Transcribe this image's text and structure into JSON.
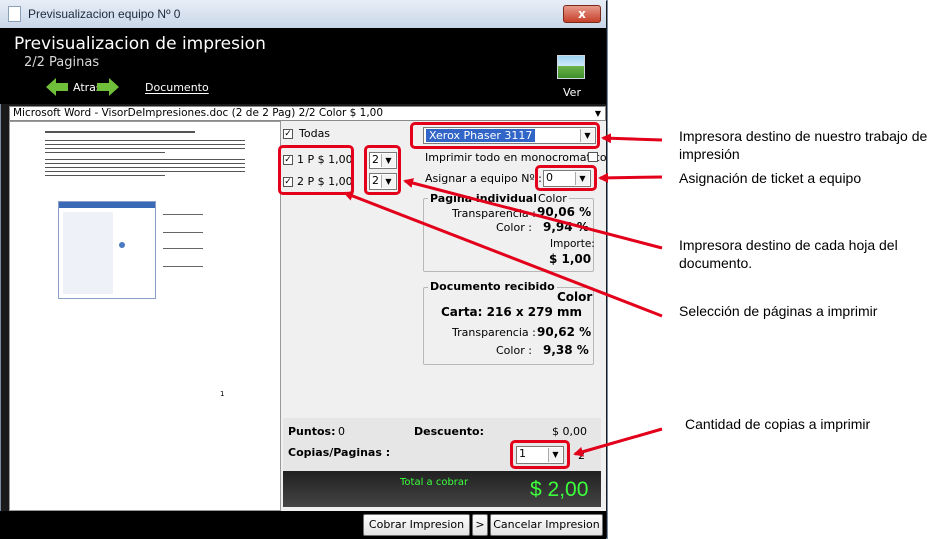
{
  "window": {
    "title": "Previsualizacion equipo Nº 0",
    "close_label": "x"
  },
  "header": {
    "title": "Previsualizacion de impresion",
    "subtitle": "2/2 Paginas",
    "back_label": "Atras",
    "document_label": "Documento",
    "ver_label": "Ver"
  },
  "document_selector": {
    "value": "Microsoft Word - VisorDeImpresiones.doc (2 de 2 Pag) 2/2 Color $ 1,00"
  },
  "preview": {
    "page_number": "1"
  },
  "pages": {
    "todas_label": "Todas",
    "todas_checked": true,
    "items": [
      {
        "label": "1 P $ 1,00",
        "checked": true,
        "printer": "2"
      },
      {
        "label": "2 P $ 1,00",
        "checked": true,
        "printer": "2"
      }
    ]
  },
  "printer": {
    "selected": "Xerox Phaser 3117",
    "monochrome_label": "Imprimir todo en monocromatico",
    "assign_label": "Asignar a equipo Nº :",
    "assign_value": "0"
  },
  "pagina_individual": {
    "legend": "Pagina individual",
    "mode": "Color",
    "transparencia_label": "Transparencia :",
    "transparencia_value": "90,06 %",
    "color_label": "Color :",
    "color_value": "9,94 %",
    "importe_label": "Importe:",
    "importe_value": "$ 1,00"
  },
  "documento_recibido": {
    "legend": "Documento recibido",
    "mode": "Color",
    "paper": "Carta: 216 x 279 mm",
    "transparencia_label": "Transparencia :",
    "transparencia_value": "90,62 %",
    "color_label": "Color :",
    "color_value": "9,38 %"
  },
  "totals": {
    "puntos_label": "Puntos:",
    "puntos_value": "0",
    "descuento_label": "Descuento:",
    "descuento_value": "$ 0,00",
    "copias_label": "Copias/Paginas :",
    "copias_value": "1",
    "copias_suffix": "2",
    "total_label": "Total a cobrar",
    "total_value": "$ 2,00"
  },
  "footer": {
    "cobrar_label": "Cobrar Impresion",
    "chevron_label": ">",
    "cancelar_label": "Cancelar Impresion"
  },
  "annotations": [
    "Impresora destino de nuestro trabajo de impresión",
    "Asignación de ticket a equipo",
    "Impresora destino de cada hoja del documento.",
    "Selección de páginas a imprimir",
    "Cantidad de copias a imprimir"
  ],
  "colors": {
    "highlight": "#e2001a",
    "total_green": "#3cff3c",
    "printer_selection": "#3166c8",
    "header_bg": "#000000"
  }
}
